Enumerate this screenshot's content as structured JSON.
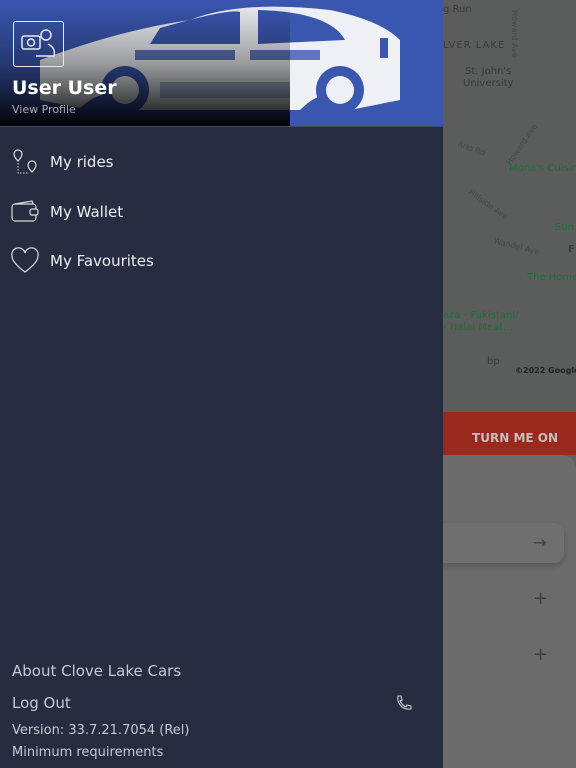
{
  "drawer": {
    "user_name": "User User",
    "view_profile": "View Profile",
    "menu": [
      {
        "label": "My rides",
        "icon": "route-pins-icon"
      },
      {
        "label": "My Wallet",
        "icon": "wallet-icon"
      },
      {
        "label": "My Favourites",
        "icon": "heart-icon"
      }
    ],
    "about": "About Clove Lake Cars",
    "logout": "Log Out",
    "version": "Version: 33.7.21.7054 (Rel)",
    "min_req": "Minimum requirements"
  },
  "map": {
    "labels": [
      "g Run",
      "LVER LAKE",
      "St. John's",
      "University",
      "Mona's Cuisine",
      "The Home",
      "aza - Pakistani/",
      "- Halal Meat...",
      "bp",
      "Sun",
      "F"
    ],
    "roads": [
      "Howard Ave",
      "Howard Ave",
      "Arlo Rd",
      "Hillside Ave",
      "Wandel Ave"
    ],
    "copyright": "©2022 Google"
  },
  "turn_on_label": "TURN ME ON",
  "colors": {
    "drawer_bg": "#282c40",
    "header_blue": "#3a57b0",
    "red_bar": "#9a2a1e"
  }
}
